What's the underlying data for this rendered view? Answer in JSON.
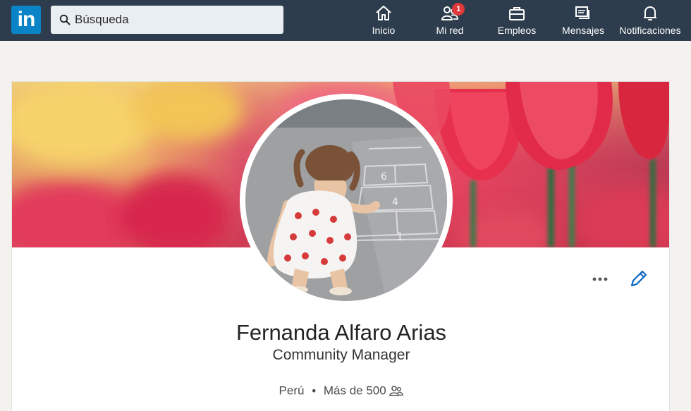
{
  "app": {
    "logo_text": "in"
  },
  "search": {
    "placeholder": "Búsqueda"
  },
  "nav": {
    "home": {
      "label": "Inicio",
      "icon": "home-icon"
    },
    "network": {
      "label": "Mi red",
      "icon": "network-icon",
      "badge": "1"
    },
    "jobs": {
      "label": "Empleos",
      "icon": "briefcase-icon"
    },
    "messages": {
      "label": "Mensajes",
      "icon": "messages-icon"
    },
    "notifications": {
      "label": "Notificaciones",
      "icon": "bell-icon"
    }
  },
  "profile": {
    "name": "Fernanda Alfaro Arias",
    "headline": "Community Manager",
    "location": "Perú",
    "separator": "•",
    "connections": "Más de 500"
  },
  "colors": {
    "topbar": "#2d3d4d",
    "brand": "#0a84c6",
    "badge": "#e0383a",
    "edit": "#0a66c2"
  }
}
